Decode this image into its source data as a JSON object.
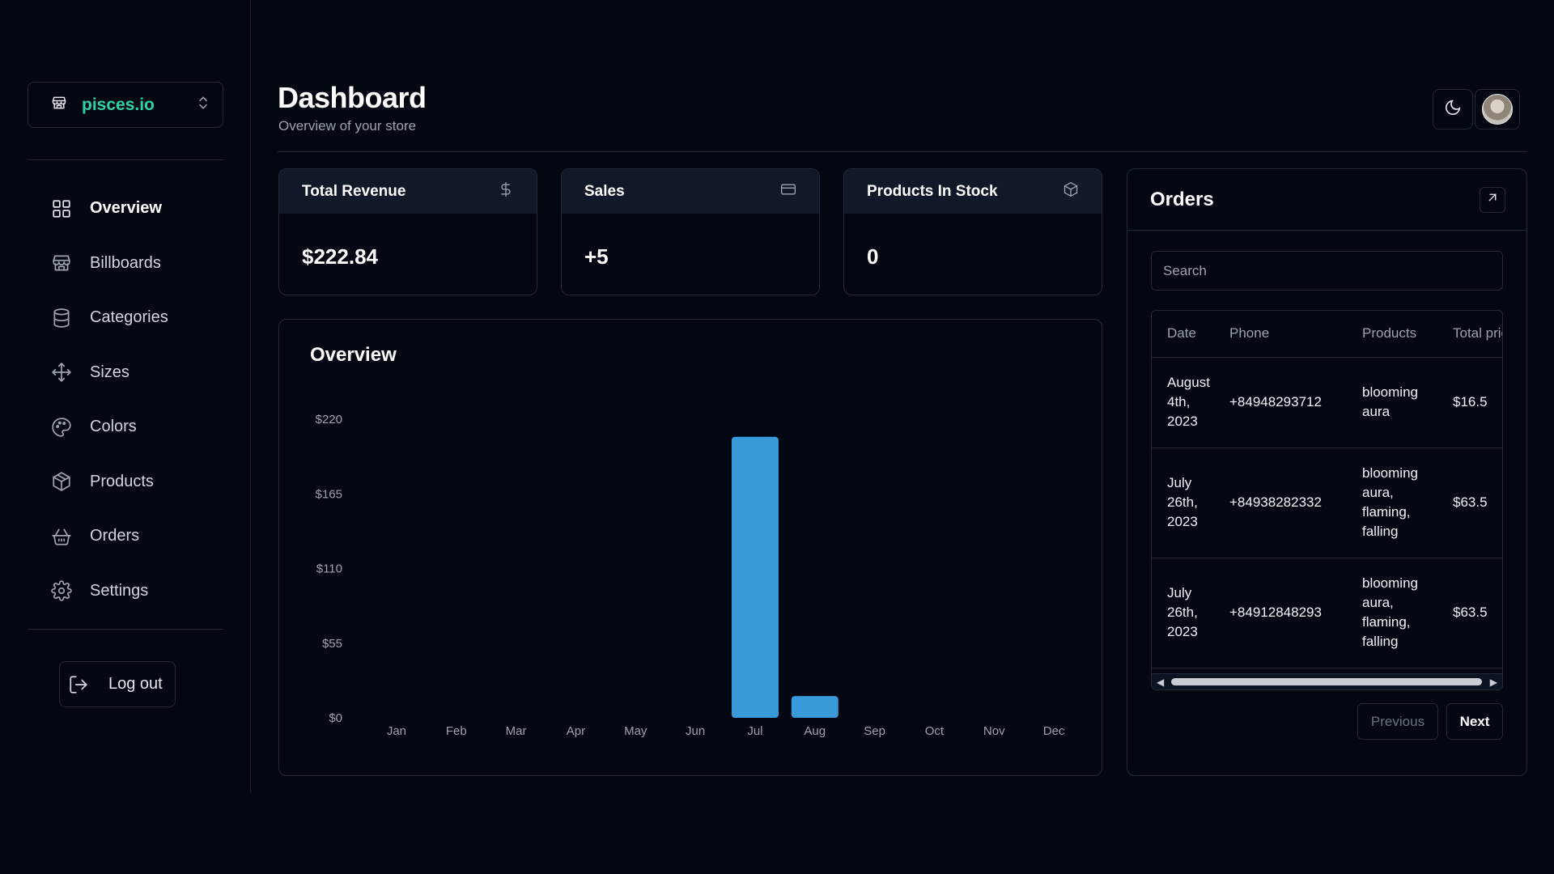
{
  "store": {
    "name": "pisces.io"
  },
  "nav": [
    {
      "label": "Overview",
      "icon": "grid-icon",
      "active": true
    },
    {
      "label": "Billboards",
      "icon": "store-icon"
    },
    {
      "label": "Categories",
      "icon": "database-icon"
    },
    {
      "label": "Sizes",
      "icon": "move-icon"
    },
    {
      "label": "Colors",
      "icon": "palette-icon"
    },
    {
      "label": "Products",
      "icon": "package-icon"
    },
    {
      "label": "Orders",
      "icon": "shopping-basket-icon"
    },
    {
      "label": "Settings",
      "icon": "gear-icon"
    }
  ],
  "logout_label": "Log out",
  "header": {
    "title": "Dashboard",
    "subtitle": "Overview of your store"
  },
  "stats": [
    {
      "title": "Total Revenue",
      "value": "$222.84",
      "icon": "dollar-icon"
    },
    {
      "title": "Sales",
      "value": "+5",
      "icon": "credit-card-icon"
    },
    {
      "title": "Products In Stock",
      "value": "0",
      "icon": "package-icon"
    }
  ],
  "overview": {
    "title": "Overview"
  },
  "chart_data": {
    "type": "bar",
    "categories": [
      "Jan",
      "Feb",
      "Mar",
      "Apr",
      "May",
      "Jun",
      "Jul",
      "Aug",
      "Sep",
      "Oct",
      "Nov",
      "Dec"
    ],
    "values": [
      0,
      0,
      0,
      0,
      0,
      0,
      207,
      16,
      0,
      0,
      0,
      0
    ],
    "yticks": [
      "$0",
      "$55",
      "$110",
      "$165",
      "$220"
    ],
    "ylim": [
      0,
      220
    ],
    "color": "#3a99d8",
    "grid": false,
    "title": "Overview",
    "xlabel": "",
    "ylabel": ""
  },
  "orders": {
    "title": "Orders",
    "search_placeholder": "Search",
    "columns": [
      "Date",
      "Phone",
      "Products",
      "Total price"
    ],
    "rows": [
      {
        "date": "August 4th, 2023",
        "phone": "+84948293712",
        "products": "blooming aura",
        "total": "$16.5"
      },
      {
        "date": "July 26th, 2023",
        "phone": "+84938282332",
        "products": "blooming aura, flaming, falling",
        "total": "$63.5"
      },
      {
        "date": "July 26th, 2023",
        "phone": "+84912848293",
        "products": "blooming aura, flaming, falling",
        "total": "$63.5"
      }
    ],
    "previous_label": "Previous",
    "next_label": "Next"
  }
}
